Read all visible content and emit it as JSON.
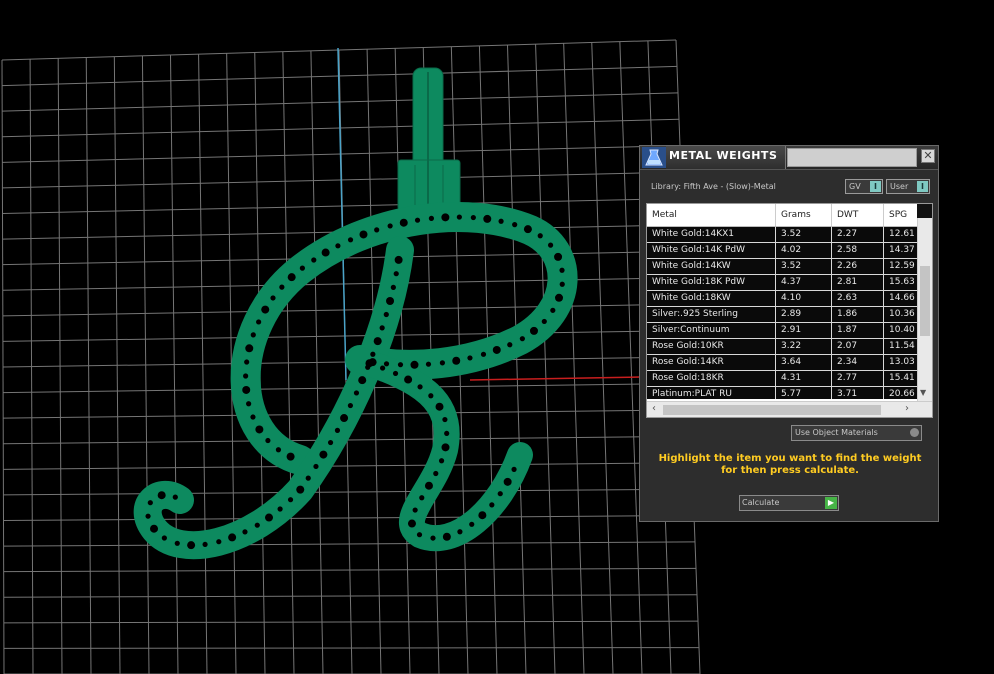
{
  "panel": {
    "title": "METAL WEIGHTS",
    "close": "✕",
    "library": "Library: Fifth Ave - (Slow)-Metal",
    "toggle_gv": "GV",
    "toggle_user": "User",
    "toggle_mark": "I",
    "columns": [
      "Metal",
      "Grams",
      "DWT",
      "SPG"
    ],
    "rows": [
      [
        "White Gold:14KX1",
        "3.52",
        "2.27",
        "12.61"
      ],
      [
        "White Gold:14K PdW",
        "4.02",
        "2.58",
        "14.37"
      ],
      [
        "White Gold:14KW",
        "3.52",
        "2.26",
        "12.59"
      ],
      [
        "White Gold:18K PdW",
        "4.37",
        "2.81",
        "15.63"
      ],
      [
        "White Gold:18KW",
        "4.10",
        "2.63",
        "14.66"
      ],
      [
        "Silver:.925 Sterling",
        "2.89",
        "1.86",
        "10.36"
      ],
      [
        "Silver:Continuum",
        "2.91",
        "1.87",
        "10.40"
      ],
      [
        "Rose Gold:10KR",
        "3.22",
        "2.07",
        "11.54"
      ],
      [
        "Rose Gold:14KR",
        "3.64",
        "2.34",
        "13.03"
      ],
      [
        "Rose Gold:18KR",
        "4.31",
        "2.77",
        "15.41"
      ],
      [
        "Platinum:PLAT RU",
        "5.77",
        "3.71",
        "20.66"
      ]
    ],
    "use_object_materials": "Use Object Materials",
    "hint": "Highlight the item you want to find the weight for then press calculate.",
    "calculate": "Calculate",
    "scroll_left": "‹",
    "scroll_right": "›",
    "scroll_down": "▼",
    "go": "▶"
  },
  "colors": {
    "model": "#0d8a5f",
    "hint": "#ffcc22",
    "axis_y": "#4aa3c8",
    "axis_x": "#c81e1e"
  }
}
